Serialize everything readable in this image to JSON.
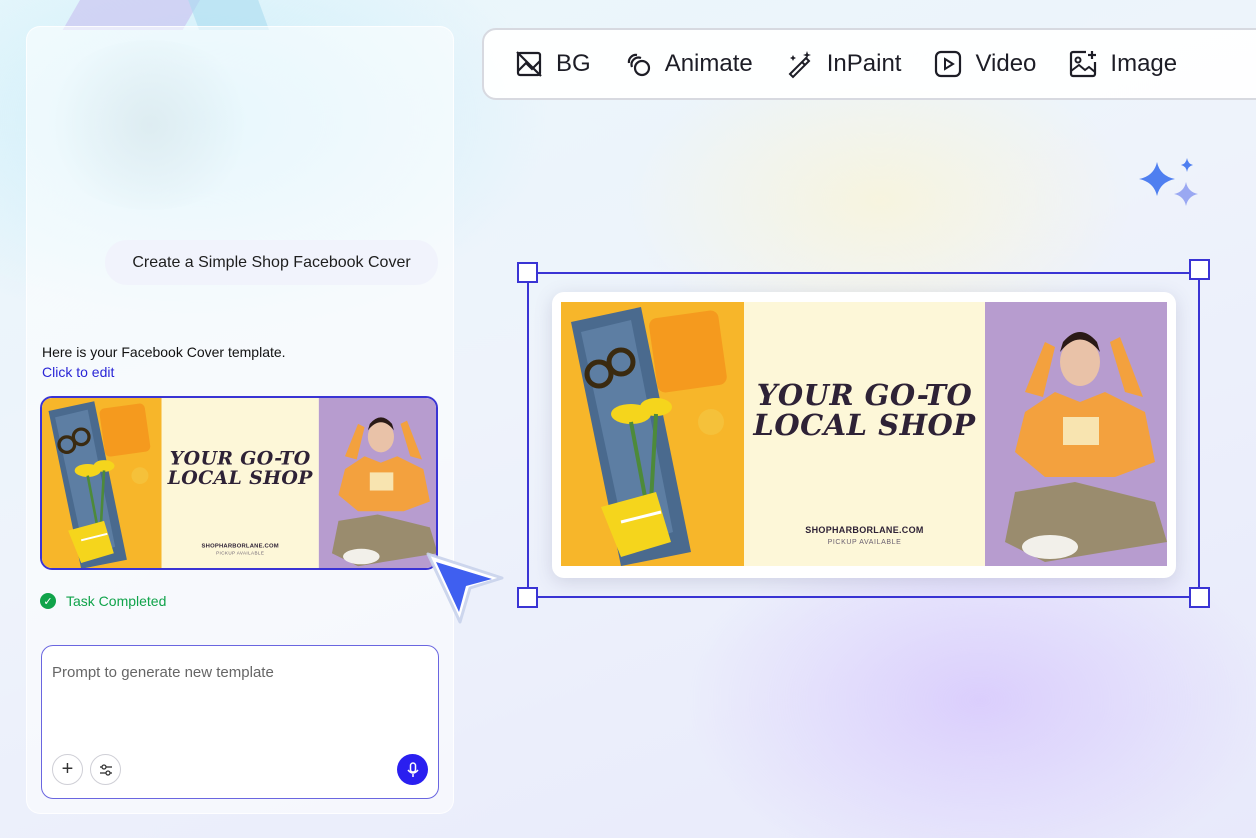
{
  "chat": {
    "user_message": "Create a Simple Shop Facebook Cover",
    "reply_text": "Here is your Facebook Cover template.",
    "edit_link": "Click to edit",
    "status": "Task Completed"
  },
  "template": {
    "headline_line1": "YOUR GO-TO",
    "headline_line2": "LOCAL SHOP",
    "website": "SHOPHARBORLANE.COM",
    "pickup": "PICKUP AVAILABLE"
  },
  "prompt": {
    "placeholder": "Prompt to generate new template"
  },
  "toolbar": {
    "items": [
      {
        "label": "BG",
        "icon": "remove-background-icon"
      },
      {
        "label": "Animate",
        "icon": "animate-icon"
      },
      {
        "label": "InPaint",
        "icon": "magic-wand-icon"
      },
      {
        "label": "Video",
        "icon": "video-play-icon"
      },
      {
        "label": "Image",
        "icon": "image-add-icon"
      }
    ]
  },
  "colors": {
    "accent": "#3a34d4",
    "success": "#10a34a",
    "mic_button": "#2a1ff0",
    "sparkle": "#4f7ff0"
  }
}
